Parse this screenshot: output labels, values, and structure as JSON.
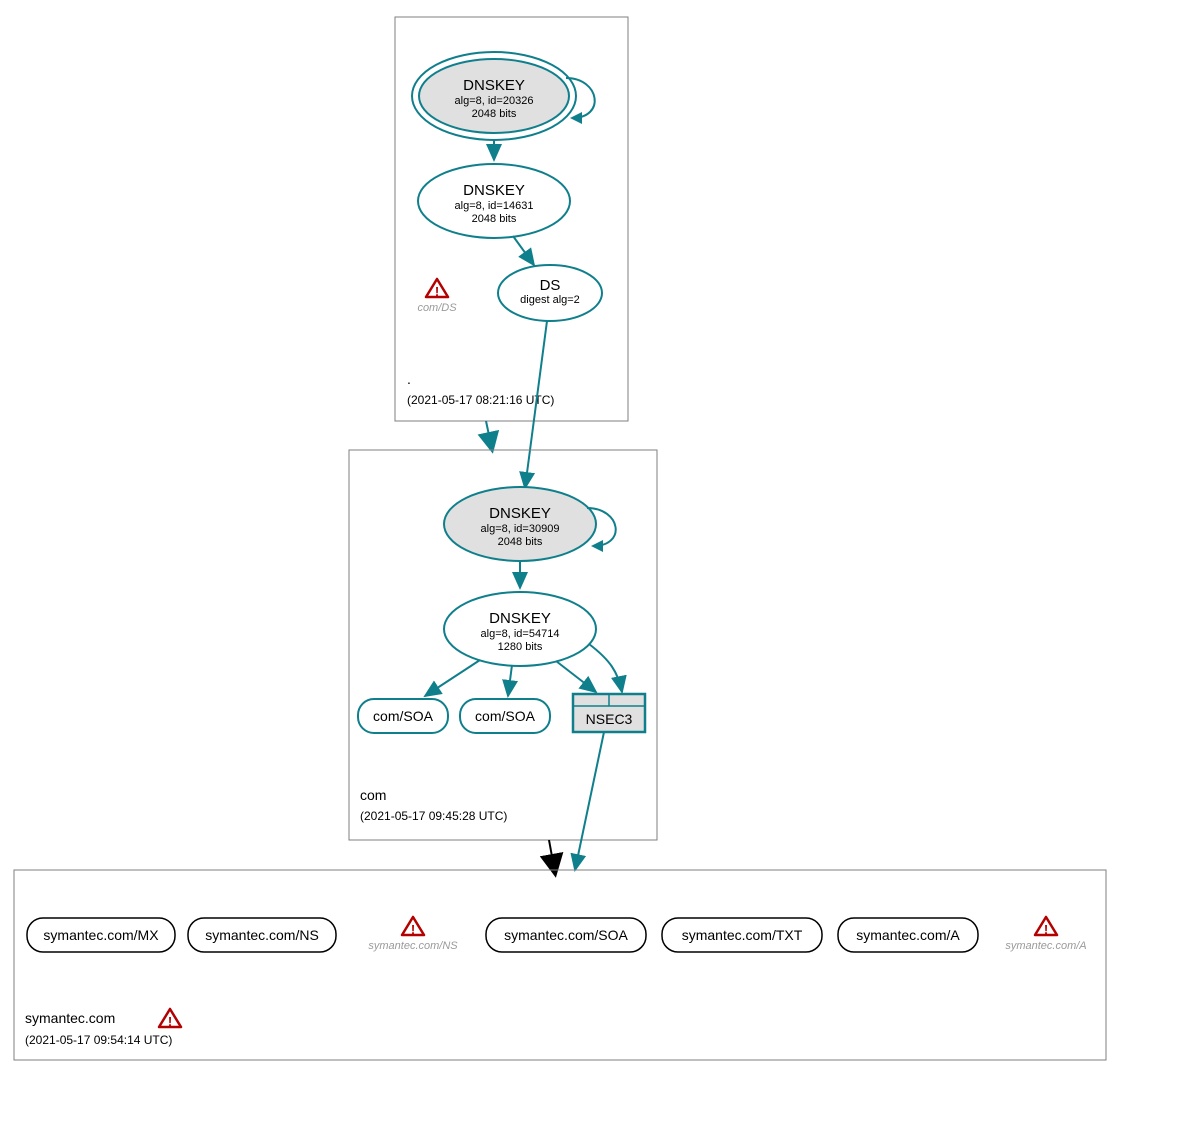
{
  "zones": {
    "root": {
      "name": ".",
      "timestamp": "(2021-05-17 08:21:16 UTC)"
    },
    "com": {
      "name": "com",
      "timestamp": "(2021-05-17 09:45:28 UTC)"
    },
    "symantec": {
      "name": "symantec.com",
      "timestamp": "(2021-05-17 09:54:14 UTC)"
    }
  },
  "nodes": {
    "root_ksk": {
      "title": "DNSKEY",
      "line1": "alg=8, id=20326",
      "line2": "2048 bits"
    },
    "root_zsk": {
      "title": "DNSKEY",
      "line1": "alg=8, id=14631",
      "line2": "2048 bits"
    },
    "root_ds": {
      "title": "DS",
      "line1": "digest alg=2"
    },
    "com_ksk": {
      "title": "DNSKEY",
      "line1": "alg=8, id=30909",
      "line2": "2048 bits"
    },
    "com_zsk": {
      "title": "DNSKEY",
      "line1": "alg=8, id=54714",
      "line2": "1280 bits"
    },
    "com_soa1": {
      "label": "com/SOA"
    },
    "com_soa2": {
      "label": "com/SOA"
    },
    "nsec3": {
      "label": "NSEC3"
    }
  },
  "warnings": {
    "com_ds": "com/DS",
    "sym_ns": "symantec.com/NS",
    "sym_a": "symantec.com/A"
  },
  "leaves": {
    "mx": "symantec.com/MX",
    "ns": "symantec.com/NS",
    "soa": "symantec.com/SOA",
    "txt": "symantec.com/TXT",
    "a": "symantec.com/A"
  }
}
